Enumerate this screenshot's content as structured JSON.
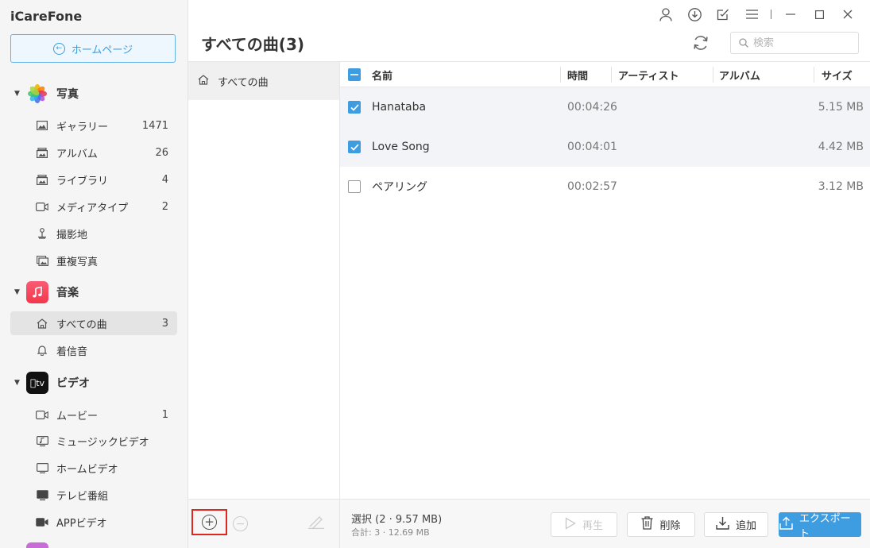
{
  "app": {
    "title": "iCareFone"
  },
  "sidebar": {
    "home_button": "ホームページ",
    "photos": {
      "label": "写真",
      "items": [
        {
          "label": "ギャラリー",
          "count": "1471",
          "icon": "image-icon"
        },
        {
          "label": "アルバム",
          "count": "26",
          "icon": "album-icon"
        },
        {
          "label": "ライブラリ",
          "count": "4",
          "icon": "library-icon"
        },
        {
          "label": "メディアタイプ",
          "count": "2",
          "icon": "video-icon"
        },
        {
          "label": "撮影地",
          "count": "",
          "icon": "location-icon"
        },
        {
          "label": "重複写真",
          "count": "",
          "icon": "duplicate-icon"
        }
      ]
    },
    "music": {
      "label": "音楽",
      "items": [
        {
          "label": "すべての曲",
          "count": "3",
          "icon": "home-icon"
        },
        {
          "label": "着信音",
          "count": "",
          "icon": "bell-icon"
        }
      ]
    },
    "video": {
      "label": "ビデオ",
      "icon_text": "tv",
      "items": [
        {
          "label": "ムービー",
          "count": "1",
          "icon": "video-icon"
        },
        {
          "label": "ミュージックビデオ",
          "count": "",
          "icon": "music-video-icon"
        },
        {
          "label": "ホームビデオ",
          "count": "",
          "icon": "monitor-icon"
        },
        {
          "label": "テレビ番組",
          "count": "",
          "icon": "tv-icon"
        },
        {
          "label": "APPビデオ",
          "count": "",
          "icon": "camera-icon"
        }
      ]
    }
  },
  "header": {
    "title": "すべての曲(3)",
    "search_placeholder": "検索"
  },
  "middle": {
    "item_label": "すべての曲"
  },
  "table": {
    "columns": {
      "name": "名前",
      "time": "時間",
      "artist": "アーティスト",
      "album": "アルバム",
      "size": "サイズ"
    },
    "rows": [
      {
        "name": "Hanataba",
        "time": "00:04:26",
        "size": "5.15 MB",
        "checked": true
      },
      {
        "name": "Love Song",
        "time": "00:04:01",
        "size": "4.42 MB",
        "checked": true
      },
      {
        "name": "ペアリング",
        "time": "00:02:57",
        "size": "3.12 MB",
        "checked": false
      }
    ]
  },
  "footer": {
    "selection": "選択 (2 · 9.57 MB)",
    "total": "合計: 3 · 12.69 MB",
    "play": "再生",
    "delete": "削除",
    "add": "追加",
    "export": "エクスポート"
  },
  "colors": {
    "accent": "#3d9de0",
    "highlight_border": "#e0281f"
  }
}
